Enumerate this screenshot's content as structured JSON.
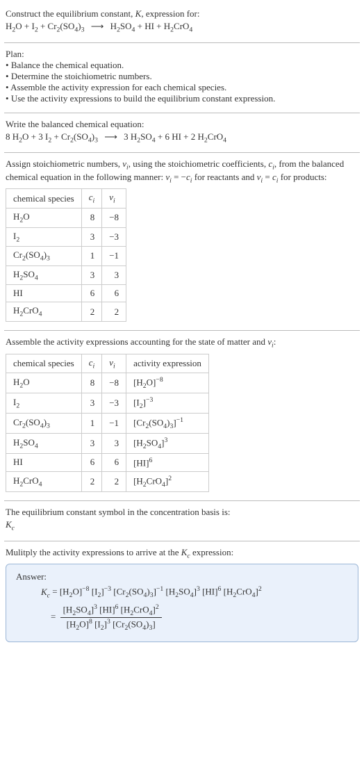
{
  "header": {
    "line1": "Construct the equilibrium constant, K, expression for:",
    "reaction_unbalanced": "H₂O + I₂ + Cr₂(SO₄)₃  ⟶  H₂SO₄ + HI + H₂CrO₄"
  },
  "plan": {
    "title": "Plan:",
    "bullets": [
      "Balance the chemical equation.",
      "Determine the stoichiometric numbers.",
      "Assemble the activity expression for each chemical species.",
      "Use the activity expressions to build the equilibrium constant expression."
    ]
  },
  "balanced": {
    "title": "Write the balanced chemical equation:",
    "reaction": "8 H₂O + 3 I₂ + Cr₂(SO₄)₃  ⟶  3 H₂SO₄ + 6 HI + 2 H₂CrO₄"
  },
  "stoich": {
    "desc": "Assign stoichiometric numbers, νᵢ, using the stoichiometric coefficients, cᵢ, from the balanced chemical equation in the following manner: νᵢ = −cᵢ for reactants and νᵢ = cᵢ for products:",
    "headers": [
      "chemical species",
      "cᵢ",
      "νᵢ"
    ],
    "rows": [
      {
        "species": "H₂O",
        "c": "8",
        "v": "−8"
      },
      {
        "species": "I₂",
        "c": "3",
        "v": "−3"
      },
      {
        "species": "Cr₂(SO₄)₃",
        "c": "1",
        "v": "−1"
      },
      {
        "species": "H₂SO₄",
        "c": "3",
        "v": "3"
      },
      {
        "species": "HI",
        "c": "6",
        "v": "6"
      },
      {
        "species": "H₂CrO₄",
        "c": "2",
        "v": "2"
      }
    ]
  },
  "activity": {
    "desc": "Assemble the activity expressions accounting for the state of matter and νᵢ:",
    "headers": [
      "chemical species",
      "cᵢ",
      "νᵢ",
      "activity expression"
    ],
    "rows": [
      {
        "species": "H₂O",
        "c": "8",
        "v": "−8",
        "expr": "[H₂O]⁻⁸"
      },
      {
        "species": "I₂",
        "c": "3",
        "v": "−3",
        "expr": "[I₂]⁻³"
      },
      {
        "species": "Cr₂(SO₄)₃",
        "c": "1",
        "v": "−1",
        "expr": "[Cr₂(SO₄)₃]⁻¹"
      },
      {
        "species": "H₂SO₄",
        "c": "3",
        "v": "3",
        "expr": "[H₂SO₄]³"
      },
      {
        "species": "HI",
        "c": "6",
        "v": "6",
        "expr": "[HI]⁶"
      },
      {
        "species": "H₂CrO₄",
        "c": "2",
        "v": "2",
        "expr": "[H₂CrO₄]²"
      }
    ]
  },
  "kc_symbol": {
    "line1": "The equilibrium constant symbol in the concentration basis is:",
    "symbol": "K_c"
  },
  "multiply": {
    "title": "Mulitply the activity expressions to arrive at the K_c expression:"
  },
  "answer": {
    "label": "Answer:",
    "kc_line": "K_c = [H₂O]⁻⁸ [I₂]⁻³ [Cr₂(SO₄)₃]⁻¹ [H₂SO₄]³ [HI]⁶ [H₂CrO₄]²",
    "frac_num": "[H₂SO₄]³ [HI]⁶ [H₂CrO₄]²",
    "frac_den": "[H₂O]⁸ [I₂]³ [Cr₂(SO₄)₃]"
  }
}
